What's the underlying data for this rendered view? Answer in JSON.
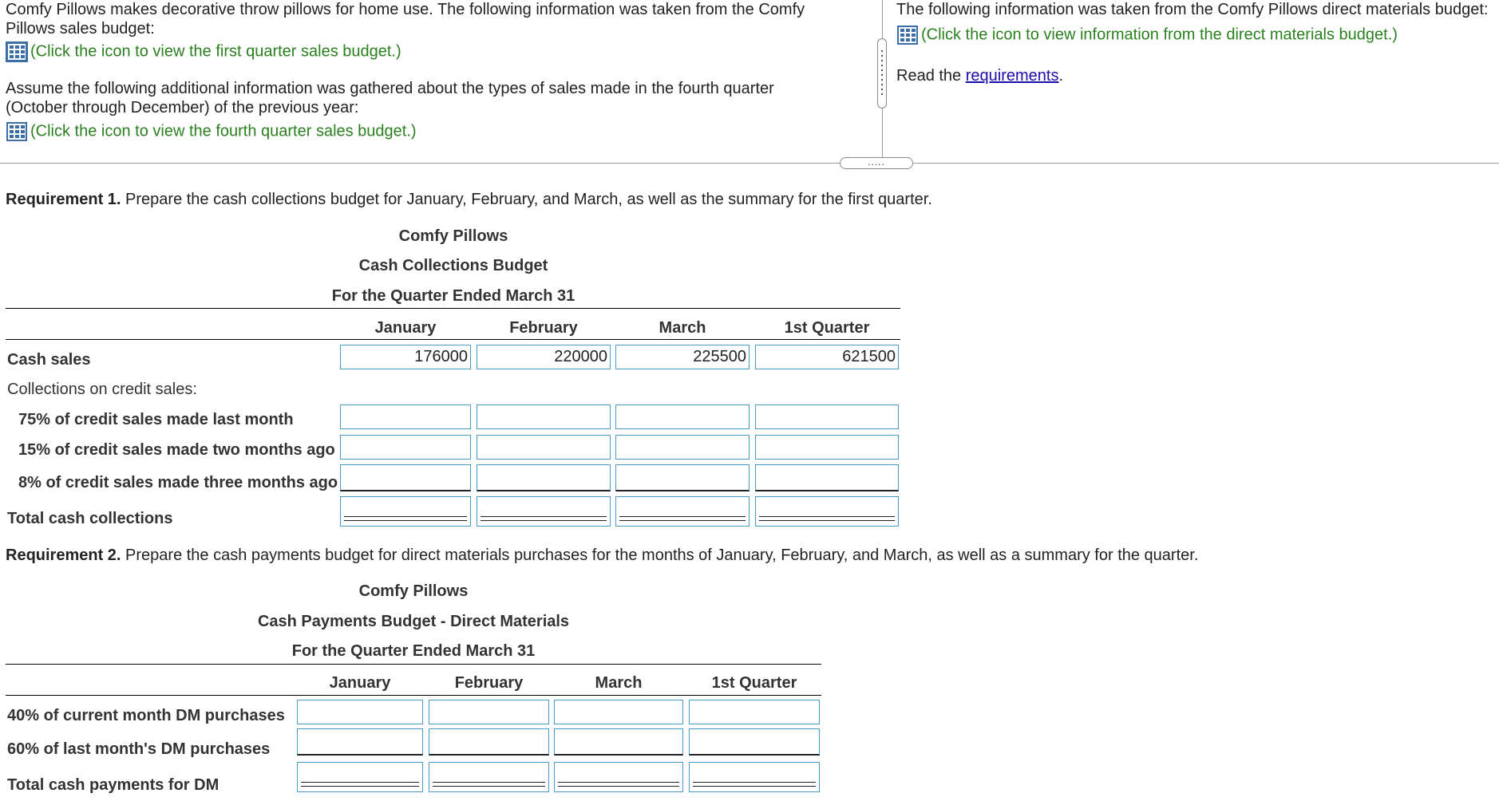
{
  "left_pane": {
    "intro": "Comfy Pillows makes decorative throw pillows for home use. The following information was taken from the Comfy Pillows sales budget:",
    "sales_budget_link": "(Click the icon to view the first quarter sales budget.)",
    "assume_text": "Assume the following additional information was gathered about the types of sales made in the fourth quarter (October through December) of the previous year:",
    "q4_link": "(Click the icon to view the fourth quarter sales budget.)"
  },
  "right_pane": {
    "intro": "The following information was taken from the Comfy Pillows direct materials budget:",
    "dm_link": "(Click the icon to view information from the direct materials budget.)",
    "read_prefix": "Read the ",
    "requirements_link": "requirements",
    "read_suffix": "."
  },
  "splitter": {
    "handle_dots": "....."
  },
  "req1": {
    "label": "Requirement 1.",
    "text": " Prepare the cash collections budget for January, February, and March, as well as the summary for the first quarter.",
    "company": "Comfy Pillows",
    "title": "Cash Collections Budget",
    "period": "For the Quarter Ended March 31",
    "columns": [
      "January",
      "February",
      "March",
      "1st Quarter"
    ],
    "rows": {
      "cash_sales": "Cash sales",
      "collections_header": "Collections on credit sales:",
      "pct75": "75% of credit sales made last month",
      "pct15": "15% of credit sales made two months ago",
      "pct8": "8% of credit sales made three months ago",
      "total": "Total cash collections"
    },
    "cash_sales_values": [
      "176000",
      "220000",
      "225500",
      "621500"
    ]
  },
  "req2": {
    "label": "Requirement 2.",
    "text": " Prepare the cash payments budget for direct materials purchases for the months of January, February, and March, as well as a summary for the quarter.",
    "company": "Comfy Pillows",
    "title": "Cash Payments Budget - Direct Materials",
    "period": "For the Quarter Ended March 31",
    "columns": [
      "January",
      "February",
      "March",
      "1st Quarter"
    ],
    "rows": {
      "pct40": "40% of current month DM purchases",
      "pct60": "60% of last month's DM purchases",
      "total": "Total cash payments for DM"
    }
  },
  "colors": {
    "link_green": "#2a7f1f",
    "input_border": "#4a9bc8",
    "icon_blue": "#3a6ea5"
  }
}
